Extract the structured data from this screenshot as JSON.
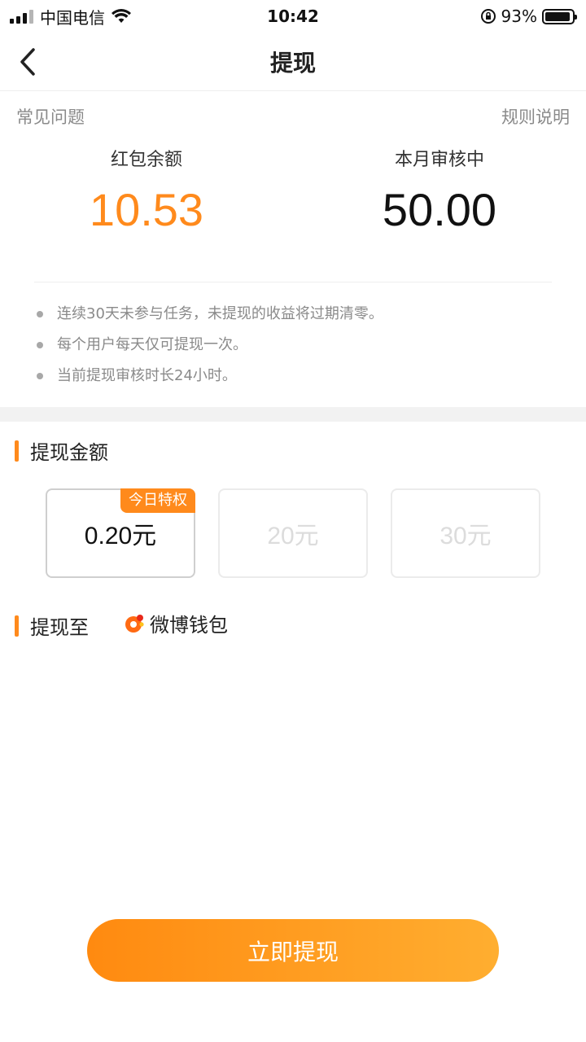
{
  "status_bar": {
    "carrier": "中国电信",
    "time": "10:42",
    "battery": "93%",
    "battery_level": 0.93,
    "icons": [
      "signal-icon",
      "wifi-icon",
      "rotation-lock-icon",
      "battery-icon"
    ]
  },
  "nav": {
    "title": "提现",
    "back_icon": "chevron-left-icon"
  },
  "links": {
    "faq": "常见问题",
    "rules": "规则说明"
  },
  "balances": {
    "redpacket_label": "红包余额",
    "redpacket_value": "10.53",
    "pending_label": "本月审核中",
    "pending_value": "50.00"
  },
  "notes": [
    "连续30天未参与任务，未提现的收益将过期清零。",
    "每个用户每天仅可提现一次。",
    "当前提现审核时长24小时。"
  ],
  "amount_section": {
    "title": "提现金额",
    "options": [
      {
        "label": "0.20元",
        "tag": "今日特权",
        "state": "selected"
      },
      {
        "label": "20元",
        "state": "disabled"
      },
      {
        "label": "30元",
        "state": "disabled"
      }
    ]
  },
  "target_section": {
    "title": "提现至",
    "wallet_label": "微博钱包",
    "wallet_icon": "weibo-wallet-icon"
  },
  "button": {
    "withdraw": "立即提现"
  },
  "colors": {
    "accent": "#ff8a1c",
    "button_start": "#ff8a10",
    "button_end": "#ffae30",
    "muted_text": "#8a8a8a"
  }
}
